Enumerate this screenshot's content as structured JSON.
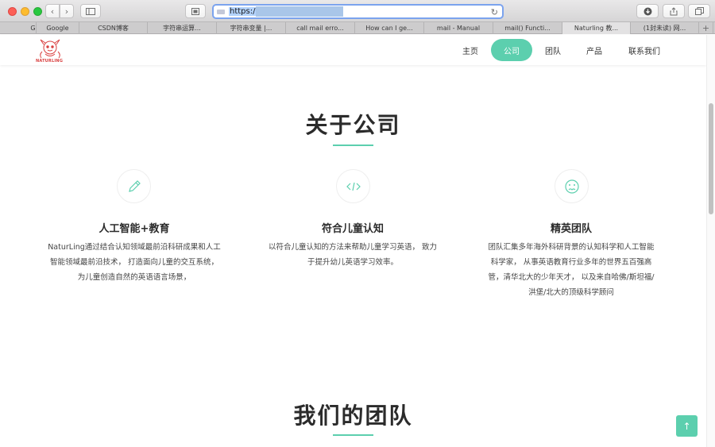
{
  "browser": {
    "url_text": "https:/",
    "tabs": [
      {
        "label": "G"
      },
      {
        "label": "Google"
      },
      {
        "label": "CSDN博客"
      },
      {
        "label": "字符串运算..."
      },
      {
        "label": "字符串变量 |..."
      },
      {
        "label": "call mail erro..."
      },
      {
        "label": "How can I ge..."
      },
      {
        "label": "mail - Manual"
      },
      {
        "label": "mail() Functi..."
      },
      {
        "label": "Naturling 教..."
      },
      {
        "label": "(1封未读) 网..."
      }
    ],
    "add_tab": "+"
  },
  "site": {
    "logo_text": "NATURLING",
    "nav": [
      {
        "label": "主页"
      },
      {
        "label": "公司"
      },
      {
        "label": "团队"
      },
      {
        "label": "产品"
      },
      {
        "label": "联系我们"
      }
    ],
    "about": {
      "title": "关于公司",
      "features": [
        {
          "icon": "pencil-icon",
          "title": "人工智能+教育",
          "lines": [
            "NaturLing通过结合认知领域最前沿科研成果和人工",
            "智能领域最前沿技术， 打造面向儿童的交互系统，",
            "为儿童创造自然的英语语言场景，"
          ]
        },
        {
          "icon": "code-icon",
          "title": "符合儿童认知",
          "lines": [
            "以符合儿童认知的方法来帮助儿童学习英语， 致力",
            "于提升幼儿英语学习效率。"
          ]
        },
        {
          "icon": "face-icon",
          "title": "精英团队",
          "lines": [
            "团队汇集多年海外科研背景的认知科学和人工智能",
            "科学家， 从事英语教育行业多年的世界五百强高",
            "管，清华北大的少年天才， 以及来自哈佛/斯坦福/",
            "洪堡/北大的顶级科学顾问"
          ]
        }
      ]
    },
    "team": {
      "title": "我们的团队"
    },
    "back_to_top": "↑"
  },
  "colors": {
    "accent": "#5ccfae",
    "text_dark": "#2b2b2b"
  }
}
